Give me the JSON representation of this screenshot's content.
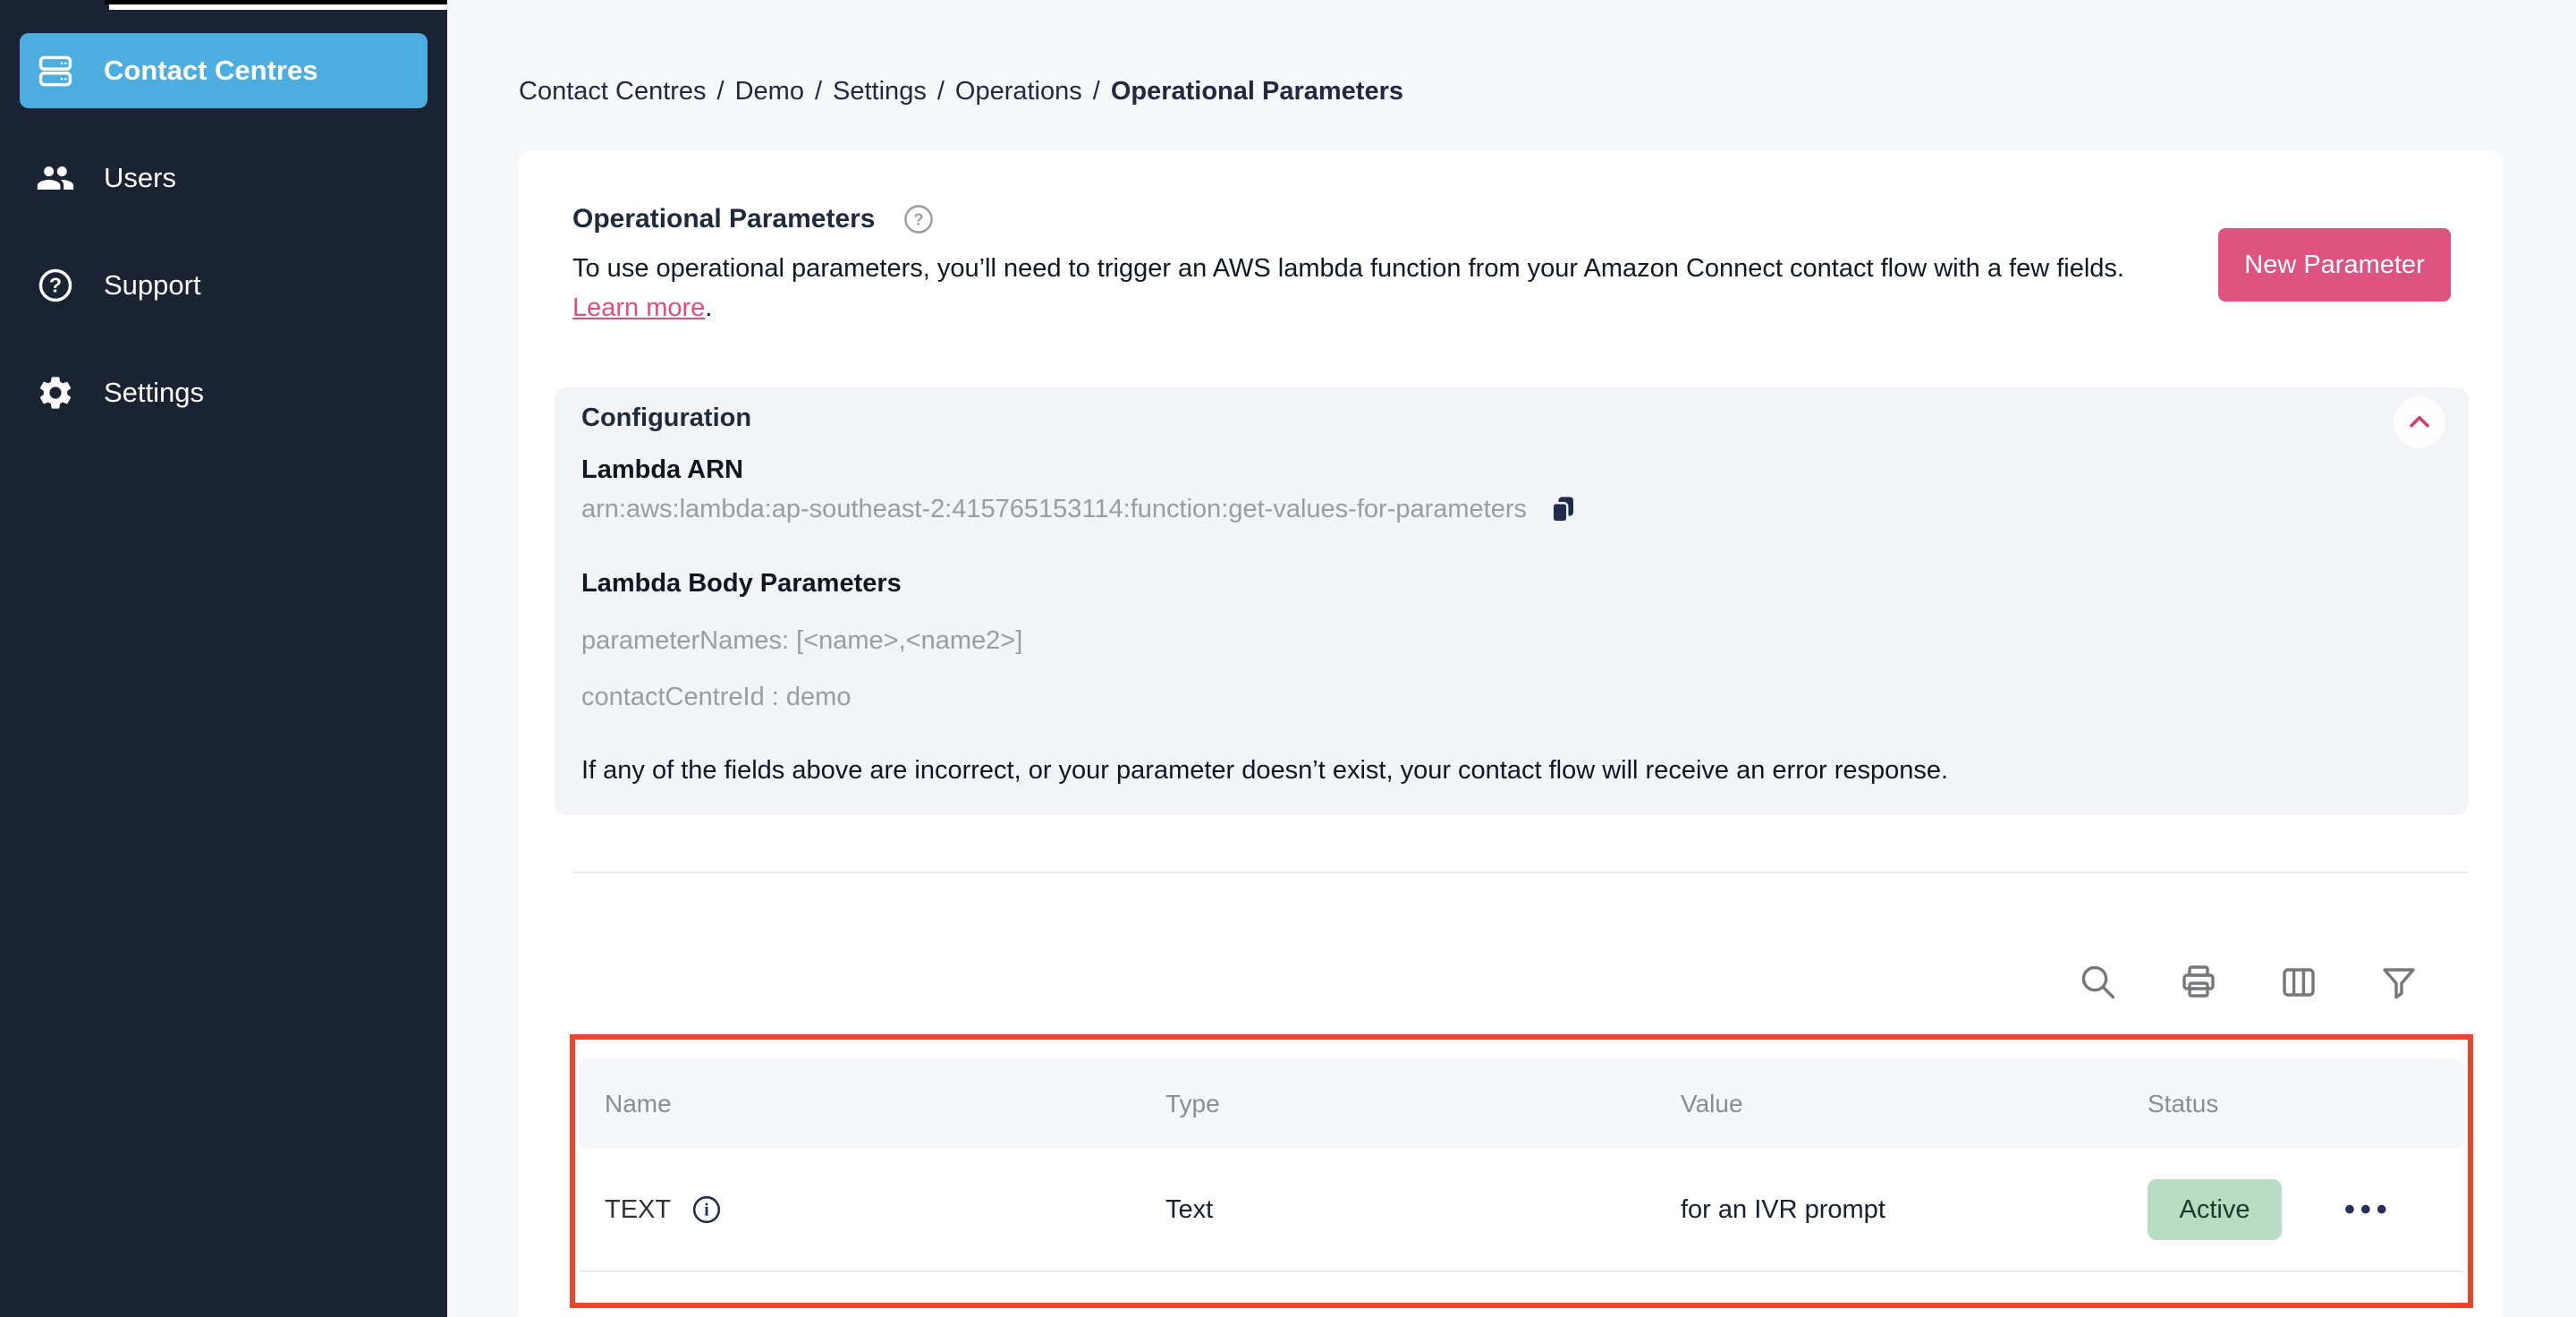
{
  "colors": {
    "sidebar_bg": "#1a2332",
    "active_item_bg": "#4cadde",
    "page_bg": "#f7f8fa",
    "accent_pink": "#dd5480",
    "link_pink": "#dd4f7e",
    "highlight_red": "#e8462e",
    "badge_green_bg": "#b7dbc3",
    "navy_text": "#1e2b3c",
    "gray_text": "#999da3"
  },
  "sidebar": {
    "items": [
      {
        "label": "Contact Centres",
        "icon": "servers-icon",
        "active": true
      },
      {
        "label": "Users",
        "icon": "users-icon",
        "active": false
      },
      {
        "label": "Support",
        "icon": "help-circle-icon",
        "active": false
      },
      {
        "label": "Settings",
        "icon": "gear-icon",
        "active": false
      }
    ]
  },
  "breadcrumb": {
    "separator": "/",
    "items": [
      "Contact Centres",
      "Demo",
      "Settings",
      "Operations"
    ],
    "current": "Operational Parameters"
  },
  "header": {
    "title": "Operational Parameters",
    "help_icon": "question-circle",
    "description_before_link": "To use operational parameters, you’ll need to trigger an AWS lambda function from your Amazon Connect contact flow with a few fields. ",
    "link_text": "Learn more",
    "description_after_link": ".",
    "new_parameter_button": "New Parameter"
  },
  "configuration": {
    "heading": "Configuration",
    "collapse_icon": "chevron-up",
    "lambda_arn_label": "Lambda ARN",
    "lambda_arn_value": "arn:aws:lambda:ap-southeast-2:415765153114:function:get-values-for-parameters",
    "copy_icon": "copy",
    "lambda_body_label": "Lambda Body Parameters",
    "parameter_names": "parameterNames: [<name>,<name2>]",
    "contact_centre_id": "contactCentreId : demo",
    "warning": "If any of the fields above are incorrect, or your parameter doesn’t exist, your contact flow will receive an error response."
  },
  "toolbar": {
    "icons": [
      "search",
      "print",
      "columns",
      "filter"
    ]
  },
  "table": {
    "columns": [
      "Name",
      "Type",
      "Value",
      "Status"
    ],
    "rows": [
      {
        "name": "TEXT",
        "info_icon": "info-circle",
        "type": "Text",
        "value": "for an IVR prompt",
        "status": "Active",
        "actions": "•••"
      }
    ]
  }
}
